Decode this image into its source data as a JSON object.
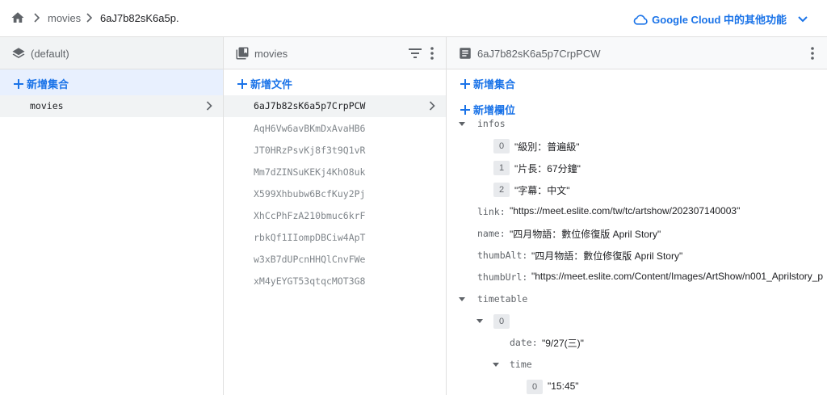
{
  "breadcrumb": {
    "items": [
      "movies",
      "6aJ7b82sK6a5p."
    ],
    "gcloud_label": "Google Cloud 中的其他功能"
  },
  "panel1": {
    "title": "(default)",
    "add_label": "新增集合",
    "items": [
      "movies"
    ]
  },
  "panel2": {
    "title": "movies",
    "add_label": "新增文件",
    "docs": [
      "6aJ7b82sK6a5p7CrpPCW",
      "AqH6Vw6avBKmDxAvaHB6",
      "JT0HRzPsvKj8f3t9Q1vR",
      "Mm7dZINSuKEKj4KhO8uk",
      "X599Xhbubw6BcfKuy2Pj",
      "XhCcPhFzA210bmuc6krF",
      "rbkQf1IIompDBCiw4ApT",
      "w3xB7dUPcnHHQlCnvFWe",
      "xM4yEYGT53qtqcMOT3G8"
    ]
  },
  "panel3": {
    "title": "6aJ7b82sK6a5p7CrpPCW",
    "add_collection_label": "新增集合",
    "add_field_label": "新增欄位",
    "infos_key": "infos",
    "infos": [
      {
        "idx": "0",
        "value": "\"級別：普遍級\""
      },
      {
        "idx": "1",
        "value": "\"片長：67分鐘\""
      },
      {
        "idx": "2",
        "value": "\"字幕：中文\""
      }
    ],
    "fields": [
      {
        "key": "link:",
        "value": "\"https://meet.eslite.com/tw/tc/artshow/202307140003\""
      },
      {
        "key": "name:",
        "value": "\"四月物語：數位修復版 April Story\""
      },
      {
        "key": "thumbAlt:",
        "value": "\"四月物語：數位修復版 April Story\""
      },
      {
        "key": "thumbUrl:",
        "value": "\"https://meet.eslite.com/Content/Images/ArtShow/n001_Aprilstory_p"
      }
    ],
    "timetable_key": "timetable",
    "timetable_idx": "0",
    "date_key": "date:",
    "date_value": "\"9/27(三)\"",
    "time_key": "time",
    "time_idx": "0",
    "time_value": "\"15:45\""
  },
  "colors": {
    "accent": "#1a73e8",
    "selected": "#e8f0fe",
    "border": "#e0e0e0"
  }
}
